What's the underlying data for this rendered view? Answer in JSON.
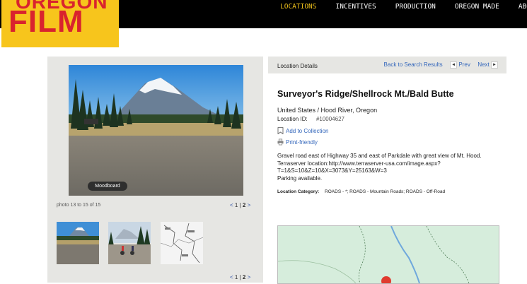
{
  "header": {
    "logo_top_text": "OREGON",
    "logo_text": "FILM",
    "nav": [
      {
        "label": "LOCATIONS",
        "active": true
      },
      {
        "label": "INCENTIVES",
        "active": false
      },
      {
        "label": "PRODUCTION",
        "active": false
      },
      {
        "label": "OREGON MADE",
        "active": false
      },
      {
        "label": "ABO",
        "active": false
      }
    ]
  },
  "gallery": {
    "moodboard_label": "Moodboard",
    "photo_count": "photo 13 to 15 of 15",
    "pager": {
      "prev": "<",
      "page1": "1",
      "sep": "|",
      "page2": "2",
      "next": ">"
    }
  },
  "details": {
    "section_label": "Location Details",
    "back_link": "Back to Search Results",
    "prev_link": "Prev",
    "next_link": "Next",
    "title": "Surveyor's Ridge/Shellrock Mt./Bald Butte",
    "region": "United States / Hood River, Oregon",
    "location_id_label": "Location ID:",
    "location_id": "#10004627",
    "add_to_collection": "Add to Collection",
    "print_friendly": "Print-friendly",
    "description": [
      "Gravel road east of Highway 35 and east of Parkdale with great view of Mt. Hood.",
      "Terraserver location:http://www.terraserver-usa.com/image.aspx?",
      "T=1&S=10&Z=10&X=3073&Y=25163&W=3",
      "Parking available."
    ],
    "category_label": "Location Category:",
    "category_value": "ROADS - *; ROADS - Mountain Roads; ROADS - Off-Road"
  },
  "colors": {
    "logo_yellow": "#f7c51c",
    "logo_red": "#d9232e",
    "nav_active": "#f0c21c",
    "link_blue": "#3366bb",
    "panel_gray": "#e6e6e3"
  }
}
